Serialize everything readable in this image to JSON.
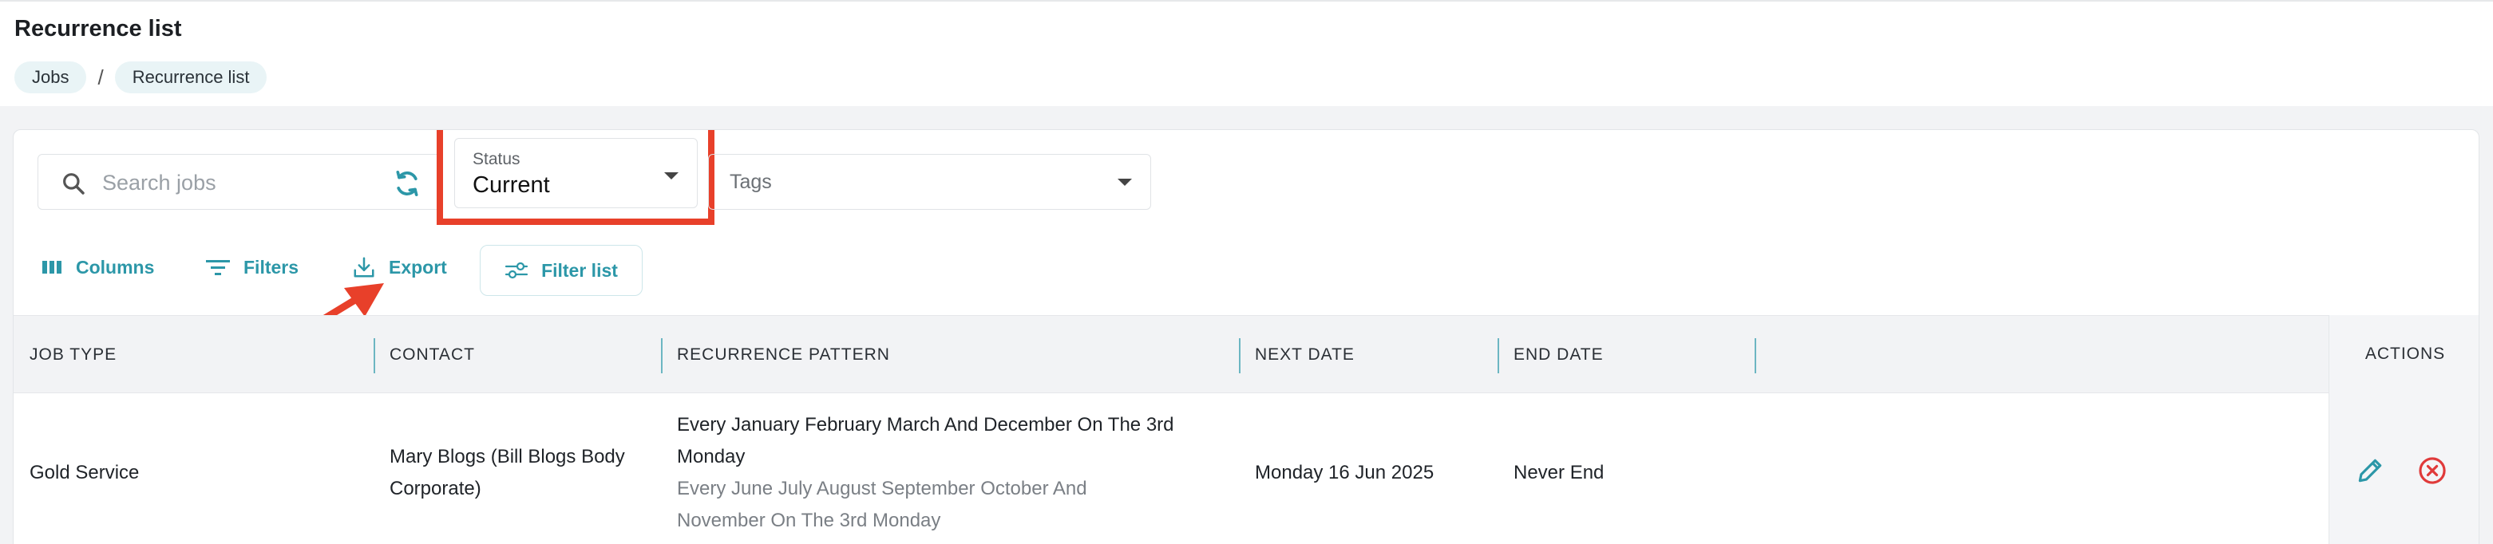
{
  "page": {
    "title": "Recurrence list"
  },
  "breadcrumb": [
    {
      "label": "Jobs"
    },
    {
      "label": "Recurrence list"
    }
  ],
  "breadcrumb_separator": "/",
  "filters": {
    "search_placeholder": "Search jobs",
    "status": {
      "label": "Status",
      "value": "Current"
    },
    "tags": {
      "placeholder": "Tags"
    }
  },
  "toolbar": {
    "columns": "Columns",
    "filters": "Filters",
    "export": "Export",
    "filter_list": "Filter list"
  },
  "table": {
    "columns": [
      "JOB TYPE",
      "CONTACT",
      "RECURRENCE PATTERN",
      "NEXT DATE",
      "END DATE"
    ],
    "actions_header": "ACTIONS",
    "rows": [
      {
        "job_type": "Gold Service",
        "contact_line1": "Mary Blogs (Bill Blogs Body",
        "contact_line2": "Corporate)",
        "pattern_line1": "Every January February March And December On The 3rd",
        "pattern_line2": "Monday",
        "pattern_line3": "Every June July August September October And",
        "pattern_line4": "November On The 3rd Monday",
        "next_date": "Monday 16 Jun 2025",
        "end_date": "Never End"
      }
    ]
  },
  "colors": {
    "accent": "#2c97a8",
    "highlight": "#e8402a",
    "danger": "#e03a3a"
  }
}
